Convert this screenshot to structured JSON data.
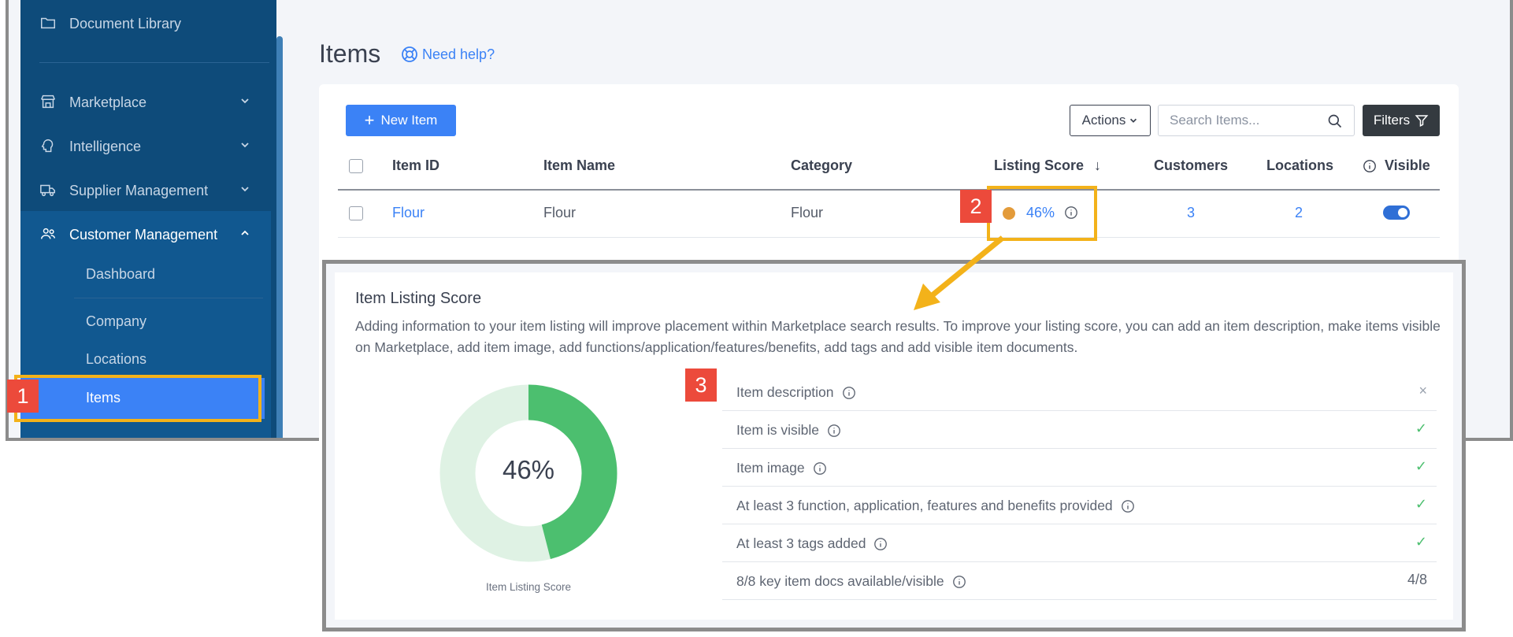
{
  "sidebar": {
    "document_library": "Document Library",
    "marketplace": "Marketplace",
    "intelligence": "Intelligence",
    "supplier_management": "Supplier Management",
    "customer_management": "Customer Management",
    "sub_items": [
      "Dashboard",
      "Company",
      "Locations",
      "Items"
    ]
  },
  "page": {
    "title": "Items",
    "help": "Need help?"
  },
  "toolbar": {
    "new_item": "New Item",
    "actions": "Actions",
    "search_placeholder": "Search Items...",
    "filters": "Filters"
  },
  "table": {
    "headers": [
      "Item ID",
      "Item Name",
      "Category",
      "Listing Score",
      "Customers",
      "Locations",
      "Visible"
    ],
    "sort_indicator": "↓",
    "rows": [
      {
        "item_id": "Flour",
        "item_name": "Flour",
        "category": "Flour",
        "listing_score": "46%",
        "customers": "3",
        "locations": "2",
        "visible": true
      }
    ]
  },
  "annotations": {
    "badge_1": "1",
    "badge_2": "2",
    "badge_3": "3",
    "accent": "#f3b21a",
    "badge_color": "#ec4a3b"
  },
  "score_panel": {
    "title": "Item Listing Score",
    "description": "Adding information to your item listing will improve placement within Marketplace search results. To improve your listing score, you can add an item description, make items visible on Marketplace, add item image, add functions/application/features/benefits, add tags and add visible item documents.",
    "score_label": "46%",
    "score_fraction": 0.46,
    "caption": "Item Listing Score",
    "criteria": [
      {
        "label": "Item description",
        "status": "×",
        "status_type": "missing"
      },
      {
        "label": "Item is visible",
        "status": "✓",
        "status_type": "ok"
      },
      {
        "label": "Item image",
        "status": "✓",
        "status_type": "ok"
      },
      {
        "label": "At least 3 function, application, features and benefits provided",
        "status": "✓",
        "status_type": "ok"
      },
      {
        "label": "At least 3 tags added",
        "status": "✓",
        "status_type": "ok"
      },
      {
        "label": "8/8 key item docs available/visible",
        "status": "4/8",
        "status_type": "count"
      }
    ]
  },
  "colors": {
    "primary": "#3b82f6",
    "sidebar": "#0e4b7a",
    "donut_fill": "#4cbf6f",
    "donut_track": "#dff2e4",
    "score_dot": "#e39b3a"
  }
}
